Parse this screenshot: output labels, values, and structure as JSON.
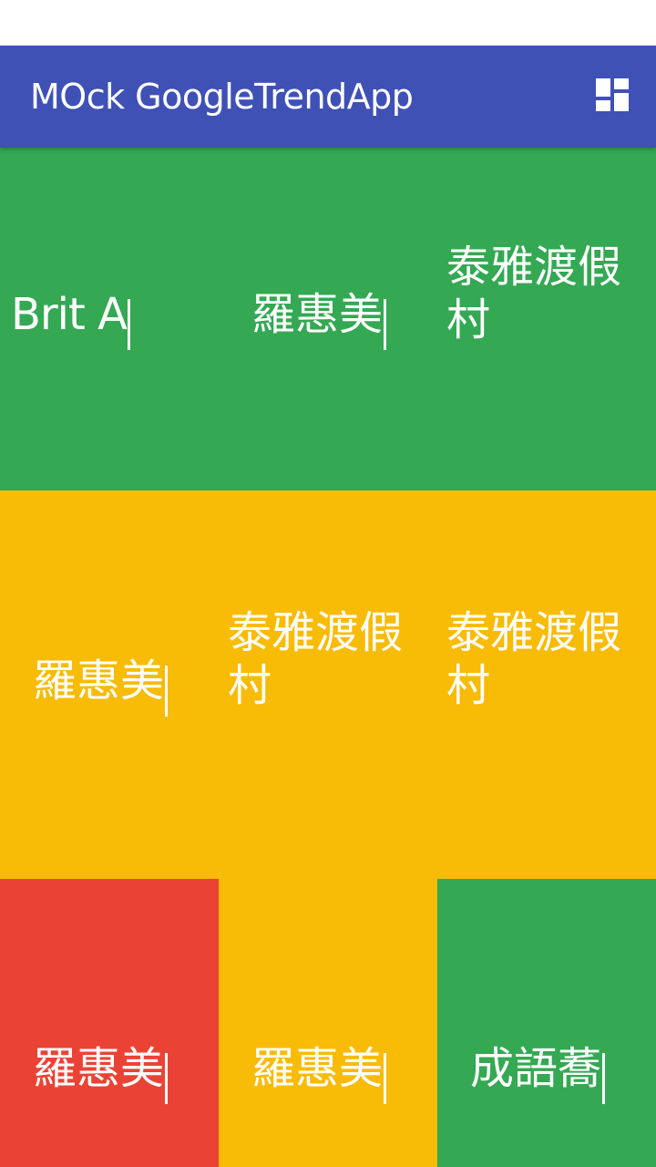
{
  "app_bar": {
    "title": "MOck GoogleTrendApp",
    "action_icon": "dashboard-icon",
    "color": "#3f51b5"
  },
  "colors": {
    "green": "#34a853",
    "yellow": "#f8bb06",
    "red": "#ea4335"
  },
  "grid": {
    "row1": [
      "Brit A",
      "羅惠美",
      "泰雅渡假村"
    ],
    "row2": [
      "羅惠美",
      "泰雅渡假村",
      "泰雅渡假村"
    ],
    "row3": [
      "羅惠美",
      "羅惠美",
      "成語蕎"
    ]
  }
}
